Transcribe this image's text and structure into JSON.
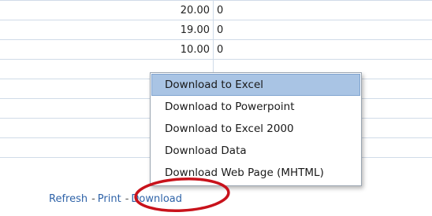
{
  "table": {
    "rows": [
      {
        "value": "20.00",
        "count": "0"
      },
      {
        "value": "19.00",
        "count": "0"
      },
      {
        "value": "10.00",
        "count": "0"
      },
      {
        "value": "",
        "count": ""
      },
      {
        "value": "",
        "count": ""
      },
      {
        "value": "",
        "count": ""
      },
      {
        "value": "",
        "count": ""
      },
      {
        "value": "",
        "count": ""
      }
    ]
  },
  "menu": {
    "items": [
      {
        "label": "Download to Excel",
        "active": true
      },
      {
        "label": "Download to Powerpoint",
        "active": false
      },
      {
        "label": "Download to Excel 2000",
        "active": false
      },
      {
        "label": "Download Data",
        "active": false
      },
      {
        "label": "Download Web Page (MHTML)",
        "active": false
      }
    ]
  },
  "footer": {
    "refresh": "Refresh",
    "print": "Print",
    "download": "Download",
    "separator": "-"
  },
  "colors": {
    "link": "#2f63a8",
    "menu_highlight": "#a9c4e4",
    "annotation_circle": "#c8121b",
    "grid_line": "#d0dbe8"
  }
}
